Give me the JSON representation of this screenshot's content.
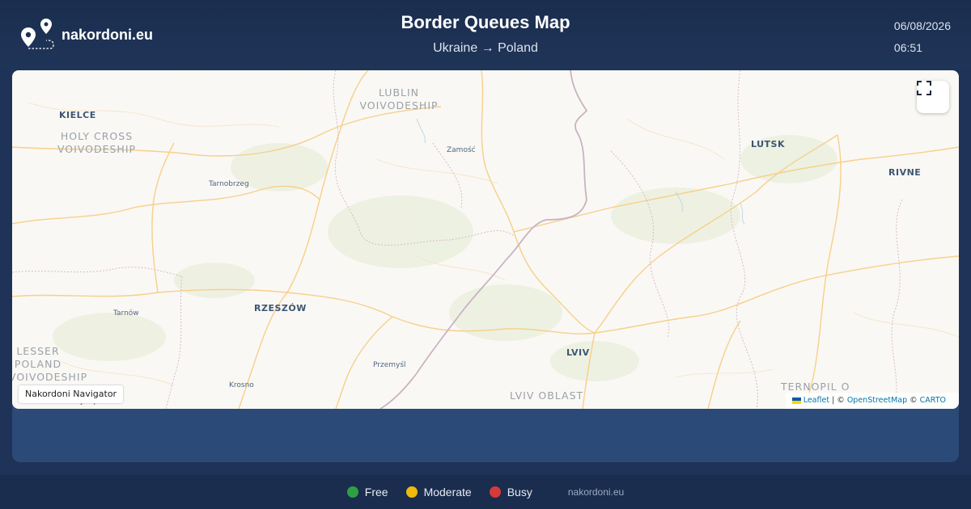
{
  "header": {
    "brand": "nakordoni.eu",
    "title": "Border Queues Map",
    "route": "Ukraine → Poland",
    "date": "06/08/2026",
    "time": "06:51"
  },
  "map": {
    "regions": {
      "lublin": "LUBLIN VOIVODESHIP",
      "holy_cross": "HOLY CROSS VOIVODESHIP",
      "lesser_poland": "LESSER POLAND VOIVODESHIP",
      "lviv_oblast": "LVIV OBLAST",
      "ternopil": "TERNOPIL O"
    },
    "cities": {
      "kielce": "KIELCE",
      "zamosc": "Zamość",
      "lutsk": "LUTSK",
      "rivne": "RIVNE",
      "tarnobrzeg": "Tarnobrzeg",
      "tarnow": "Tarnów",
      "rzeszow": "RZESZÓW",
      "lviv": "LVIV",
      "przemysl": "Przemyśl",
      "krosno": "Krosno",
      "nowy_sacz": "Nowy Sącz"
    },
    "navigator_label": "Nakordoni Navigator",
    "fullscreen_icon": "fullscreen-icon",
    "attribution": {
      "leaflet": "Leaflet",
      "separator": " | © ",
      "osm": "OpenStreetMap",
      "copy": " © ",
      "carto": "CARTO"
    }
  },
  "legend": {
    "items": [
      {
        "label": "Free",
        "color": "#2ea043"
      },
      {
        "label": "Moderate",
        "color": "#f0b90b"
      },
      {
        "label": "Busy",
        "color": "#d63a3a"
      }
    ],
    "site": "nakordoni.eu"
  },
  "colors": {
    "header_bg": "#1a2d4e",
    "panel_bg": "#2c4a78",
    "map_bg": "#faf8f4",
    "road": "#f7cf82",
    "border": "#c6a9c0"
  }
}
